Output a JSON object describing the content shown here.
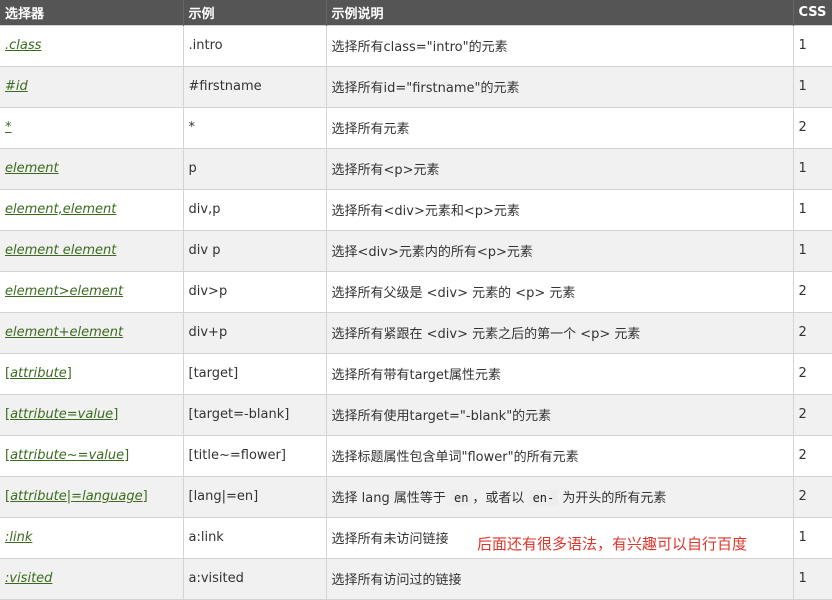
{
  "headers": {
    "selector": "选择器",
    "example": "示例",
    "description": "示例说明",
    "css": "CSS"
  },
  "rows": [
    {
      "selector": ".class",
      "example": ".intro",
      "description": "选择所有class=\"intro\"的元素",
      "css": "1"
    },
    {
      "selector": "#id",
      "example": "#firstname",
      "description": "选择所有id=\"firstname\"的元素",
      "css": "1"
    },
    {
      "selector": "*",
      "example": "*",
      "description": "选择所有元素",
      "css": "2"
    },
    {
      "selector": "element",
      "example": "p",
      "description": "选择所有<p>元素",
      "css": "1"
    },
    {
      "selector": "element,element",
      "example": "div,p",
      "description": "选择所有<div>元素和<p>元素",
      "css": "1"
    },
    {
      "selector": "element element",
      "example": "div p",
      "description": "选择<div>元素内的所有<p>元素",
      "css": "1"
    },
    {
      "selector": "element>element",
      "example": "div>p",
      "description": "选择所有父级是 <div> 元素的 <p> 元素",
      "css": "2"
    },
    {
      "selector": "element+element",
      "example": "div+p",
      "description": "选择所有紧跟在 <div> 元素之后的第一个 <p> 元素",
      "css": "2"
    },
    {
      "selector_parts": {
        "open": "[",
        "name": "attribute",
        "close": "]"
      },
      "example": "[target]",
      "description": "选择所有带有target属性元素",
      "css": "2"
    },
    {
      "selector_parts": {
        "open": "[",
        "name": "attribute=value",
        "close": "]"
      },
      "example": "[target=-blank]",
      "description": "选择所有使用target=\"-blank\"的元素",
      "css": "2"
    },
    {
      "selector_parts": {
        "open": "[",
        "name": "attribute~=value",
        "close": "]"
      },
      "example": "[title~=flower]",
      "description": "选择标题属性包含单词\"flower\"的所有元素",
      "css": "2"
    },
    {
      "selector_parts": {
        "open": "[",
        "name": "attribute",
        "mid": "|=",
        "name2": "language",
        "close": "]"
      },
      "example": "[lang|=en]",
      "description_parts": {
        "pre": "选择 lang 属性等于 ",
        "code1": "en",
        "mid": "，或者以 ",
        "code2": "en-",
        "post": " 为开头的所有元素"
      },
      "css": "2"
    },
    {
      "selector": ":link",
      "example": "a:link",
      "description": "选择所有未访问链接",
      "css": "1"
    },
    {
      "selector": ":visited",
      "example": "a:visited",
      "description": "选择所有访问过的链接",
      "css": "1"
    }
  ],
  "note": "后面还有很多语法，有兴趣可以自行百度",
  "colors": {
    "header_bg": "#555555",
    "link": "#3b6b1e",
    "note": "#e0352b",
    "stripe": "#f1f1f1"
  }
}
